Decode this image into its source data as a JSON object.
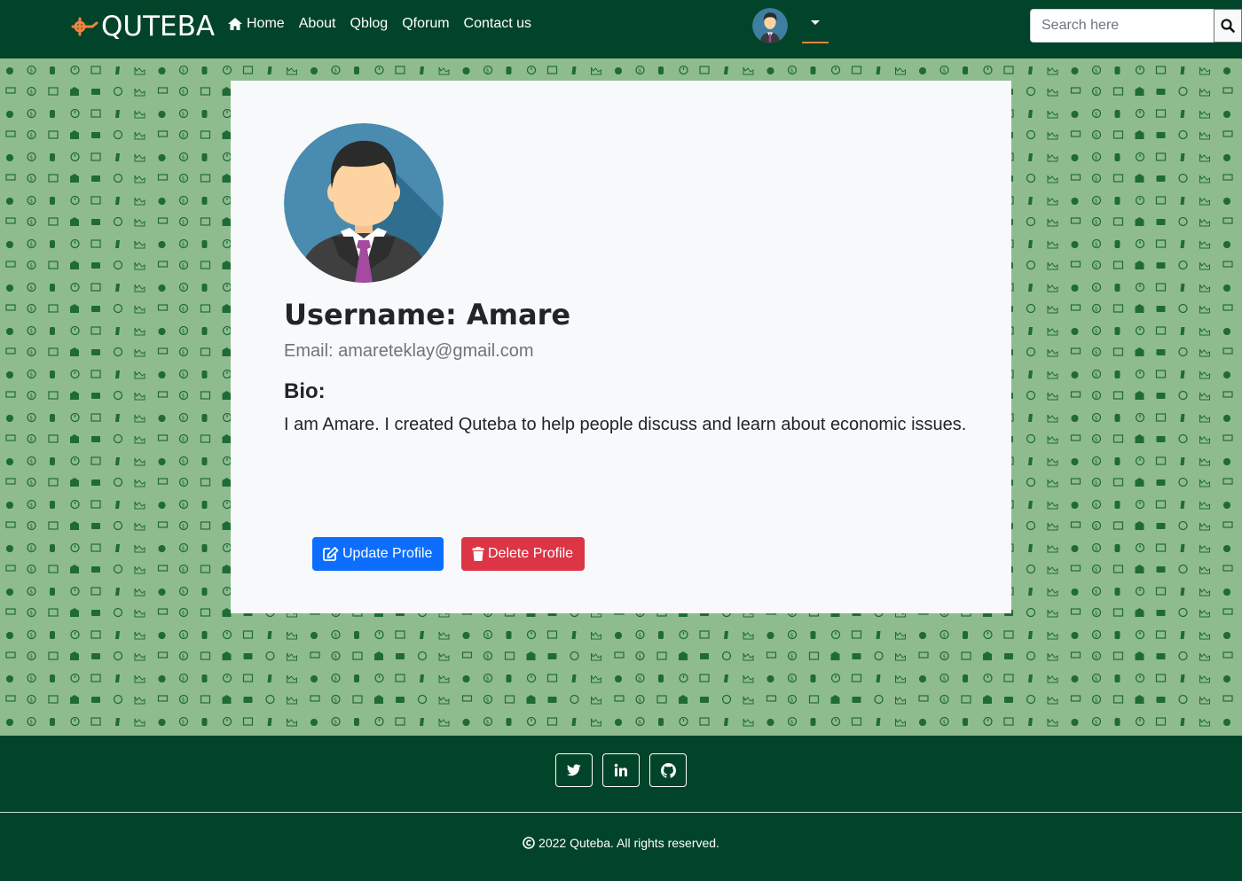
{
  "brand": {
    "name": "QUTEBA",
    "logo_icon": "quteba-logo-icon",
    "accent_color": "#f0833f"
  },
  "nav": {
    "items": [
      {
        "label": "Home",
        "icon": "home-icon"
      },
      {
        "label": "About"
      },
      {
        "label": "Qblog"
      },
      {
        "label": "Qforum"
      },
      {
        "label": "Contact us"
      }
    ],
    "search": {
      "placeholder": "Search here",
      "icon": "search-icon"
    }
  },
  "profile": {
    "username": "Username: Amare",
    "email": "Email: amareteklay@gmail.com",
    "bio_heading": "Bio:",
    "bio": "I am Amare. I created Quteba to help people discuss and learn about economic issues.",
    "update_label": "Update Profile",
    "delete_label": "Delete Profile"
  },
  "footer": {
    "social": [
      "twitter-icon",
      "linkedin-icon",
      "github-icon"
    ],
    "copyright": "2022 Quteba. All rights reserved."
  },
  "colors": {
    "nav_bg": "#024429",
    "pattern_bg": "#8fbc8f",
    "pattern_icon": "#1f6b35",
    "card_bg": "#f8f9fa",
    "primary": "#0d6efd",
    "danger": "#dc3545"
  }
}
